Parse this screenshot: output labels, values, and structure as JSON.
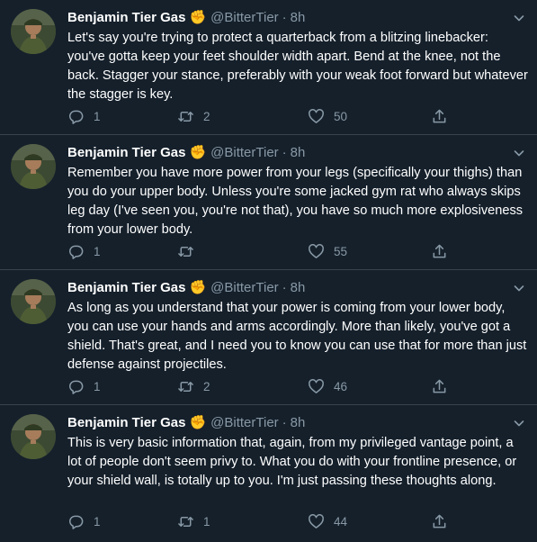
{
  "tweets": [
    {
      "name": "Benjamin Tier Gas",
      "badge": "✊",
      "handle": "@BitterTier",
      "separator": "·",
      "time": "8h",
      "text": "Let's say you're trying to protect a quarterback from a blitzing linebacker: you've gotta keep your feet shoulder width apart. Bend at the knee, not the back. Stagger your stance, preferably with your weak foot forward but whatever the stagger is key.",
      "replies": "1",
      "retweets": "2",
      "likes": "50"
    },
    {
      "name": "Benjamin Tier Gas",
      "badge": "✊",
      "handle": "@BitterTier",
      "separator": "·",
      "time": "8h",
      "text": "Remember you have more power from your legs (specifically your thighs) than you do your upper body. Unless you're some jacked gym rat who always skips leg day (I've seen you, you're not that), you have so much more explosiveness from your lower body.",
      "replies": "1",
      "retweets": "",
      "likes": "55"
    },
    {
      "name": "Benjamin Tier Gas",
      "badge": "✊",
      "handle": "@BitterTier",
      "separator": "·",
      "time": "8h",
      "text": "As long as you understand that your power is coming from your lower body, you can use your hands and arms accordingly. More than likely, you've got a shield. That's great, and I need you to know you can use that for more than just defense against projectiles.",
      "replies": "1",
      "retweets": "2",
      "likes": "46"
    },
    {
      "name": "Benjamin Tier Gas",
      "badge": "✊",
      "handle": "@BitterTier",
      "separator": "·",
      "time": "8h",
      "text": "This is very basic information that, again, from my privileged vantage point, a lot of people don't seem privy to. What you do with your frontline presence, or your shield wall, is totally up to you. I'm just passing these thoughts along.",
      "replies": "1",
      "retweets": "1",
      "likes": "44"
    }
  ],
  "icons": {
    "reply": "reply-icon",
    "retweet": "retweet-icon",
    "like": "heart-icon",
    "share": "share-icon",
    "more": "chevron-down-icon"
  },
  "colors": {
    "background": "#15202b",
    "secondary_text": "#8899a6",
    "divider": "#38444d",
    "badge": "#ffcc4d"
  }
}
